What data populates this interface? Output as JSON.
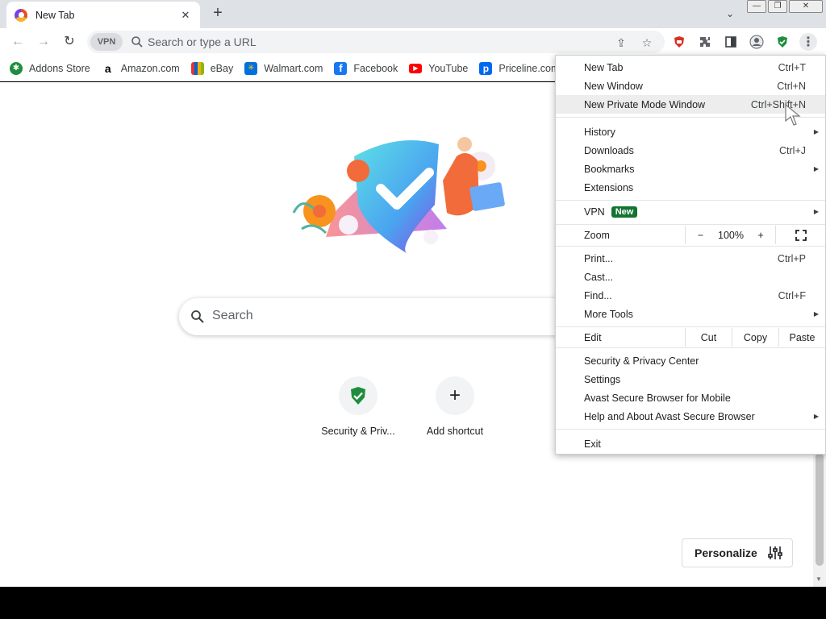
{
  "tab": {
    "title": "New Tab",
    "close_glyph": "✕"
  },
  "tabstrip": {
    "new_tab_glyph": "+",
    "search_tabs_glyph": "⌄"
  },
  "window": {
    "minimize": "—",
    "restore": "❐",
    "close": "✕"
  },
  "toolbar": {
    "back_glyph": "←",
    "forward_glyph": "→",
    "reload_glyph": "↻",
    "vpn_label": "VPN",
    "omnibox_placeholder": "Search or type a URL",
    "share_glyph": "⇪",
    "star_glyph": "☆",
    "more_glyph": "⋮"
  },
  "bookmarks": [
    {
      "label": "Addons Store",
      "icon": "addons-store-icon",
      "color": "#1e8e3e",
      "glyph": "✱"
    },
    {
      "label": "Amazon.com",
      "icon": "amazon-icon",
      "color": "#ffffff",
      "glyph": "a"
    },
    {
      "label": "eBay",
      "icon": "ebay-icon",
      "color": "#ffffff",
      "glyph": ""
    },
    {
      "label": "Walmart.com",
      "icon": "walmart-icon",
      "color": "#0071dc",
      "glyph": "✳"
    },
    {
      "label": "Facebook",
      "icon": "facebook-icon",
      "color": "#1877f2",
      "glyph": "f"
    },
    {
      "label": "YouTube",
      "icon": "youtube-icon",
      "color": "#ff0000",
      "glyph": "▶"
    },
    {
      "label": "Priceline.com",
      "icon": "priceline-icon",
      "color": "#0068ef",
      "glyph": "p"
    }
  ],
  "content": {
    "search_placeholder": "Search",
    "shortcuts": [
      {
        "label": "Security & Priv...",
        "icon": "shield-check-icon"
      },
      {
        "label": "Add shortcut",
        "icon": "plus-icon",
        "glyph": "+"
      }
    ],
    "personalize_label": "Personalize"
  },
  "menu": {
    "new_tab": {
      "label": "New Tab",
      "shortcut": "Ctrl+T"
    },
    "new_window": {
      "label": "New Window",
      "shortcut": "Ctrl+N"
    },
    "new_private": {
      "label": "New Private Mode Window",
      "shortcut": "Ctrl+Shift+N"
    },
    "history": {
      "label": "History"
    },
    "downloads": {
      "label": "Downloads",
      "shortcut": "Ctrl+J"
    },
    "bookmarks": {
      "label": "Bookmarks"
    },
    "extensions": {
      "label": "Extensions"
    },
    "vpn": {
      "label": "VPN",
      "badge": "New"
    },
    "zoom": {
      "label": "Zoom",
      "minus": "−",
      "value": "100%",
      "plus": "+",
      "fullscreen_glyph": "⛶"
    },
    "print": {
      "label": "Print...",
      "shortcut": "Ctrl+P"
    },
    "cast": {
      "label": "Cast..."
    },
    "find": {
      "label": "Find...",
      "shortcut": "Ctrl+F"
    },
    "more_tools": {
      "label": "More Tools"
    },
    "edit": {
      "label": "Edit",
      "cut": "Cut",
      "copy": "Copy",
      "paste": "Paste"
    },
    "security_center": {
      "label": "Security & Privacy Center"
    },
    "settings": {
      "label": "Settings"
    },
    "mobile": {
      "label": "Avast Secure Browser for Mobile"
    },
    "help": {
      "label": "Help and About Avast Secure Browser"
    },
    "exit": {
      "label": "Exit"
    },
    "submenu_arrow": "▶"
  },
  "colors": {
    "accent_green": "#137333",
    "hover_row": "#ededed"
  }
}
